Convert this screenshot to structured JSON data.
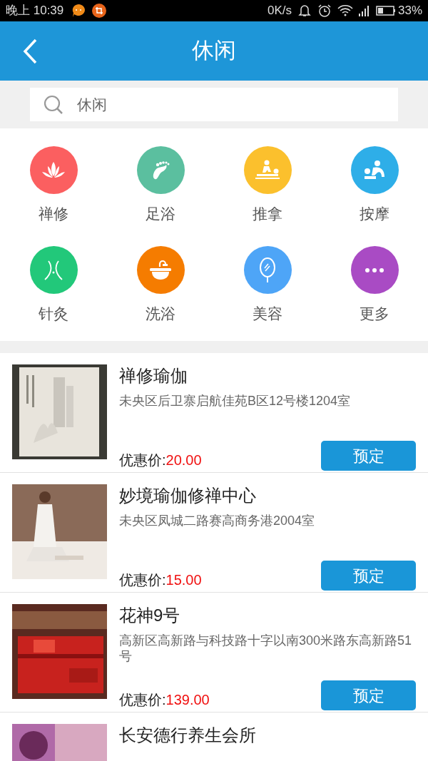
{
  "status_bar": {
    "time": "晚上 10:39",
    "speed": "0K/s",
    "battery": "33%"
  },
  "header": {
    "title": "休闲"
  },
  "search": {
    "value": "休闲"
  },
  "categories": [
    {
      "label": "禅修",
      "kind": "lotus",
      "color": "#fb5f60"
    },
    {
      "label": "足浴",
      "kind": "foot",
      "color": "#5bbf9f"
    },
    {
      "label": "推拿",
      "kind": "massage",
      "color": "#fbc02d"
    },
    {
      "label": "按摩",
      "kind": "spa",
      "color": "#2eaee8"
    },
    {
      "label": "针灸",
      "kind": "needle",
      "color": "#22c87a"
    },
    {
      "label": "洗浴",
      "kind": "bath",
      "color": "#f57c00"
    },
    {
      "label": "美容",
      "kind": "mirror",
      "color": "#4ea5f7"
    },
    {
      "label": "更多",
      "kind": "more",
      "color": "#a94bc4"
    }
  ],
  "listings": [
    {
      "name": "禅修瑜伽",
      "address": "未央区后卫寨启航佳苑B区12号楼1204室",
      "price_label": "优惠价:",
      "price": "20.00",
      "button": "预定"
    },
    {
      "name": "妙境瑜伽修禅中心",
      "address": "未央区凤城二路赛高商务港2004室",
      "price_label": "优惠价:",
      "price": "15.00",
      "button": "预定"
    },
    {
      "name": "花神9号",
      "address": "高新区高新路与科技路十字以南300米路东高新路51号",
      "price_label": "优惠价:",
      "price": "139.00",
      "button": "预定"
    },
    {
      "name": "长安德行养生会所"
    }
  ]
}
